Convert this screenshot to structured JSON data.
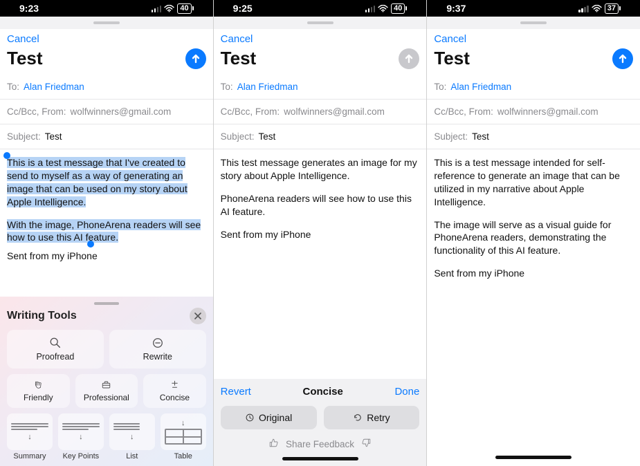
{
  "screens": [
    {
      "status": {
        "time": "9:23",
        "battery": "40"
      },
      "cancel": "Cancel",
      "title": "Test",
      "send_enabled": true,
      "to_label": "To:",
      "to_value": "Alan Friedman",
      "cc_label": "Cc/Bcc, From:",
      "cc_value": "wolfwinners@gmail.com",
      "subject_label": "Subject:",
      "subject_value": "Test",
      "body_selected_p1": "This is a test message that I've created to send to myself as a way of generating an image that can be used on my story about Apple Intelligence.",
      "body_selected_p2": "With the image, PhoneArena readers will see how to use this AI feature.",
      "signature": "Sent from my iPhone",
      "writing_tools": {
        "title": "Writing Tools",
        "proofread": "Proofread",
        "rewrite": "Rewrite",
        "friendly": "Friendly",
        "professional": "Professional",
        "concise": "Concise",
        "summary": "Summary",
        "key_points": "Key Points",
        "list": "List",
        "table": "Table"
      }
    },
    {
      "status": {
        "time": "9:25",
        "battery": "40"
      },
      "cancel": "Cancel",
      "title": "Test",
      "send_enabled": false,
      "to_label": "To:",
      "to_value": "Alan Friedman",
      "cc_label": "Cc/Bcc, From:",
      "cc_value": "wolfwinners@gmail.com",
      "subject_label": "Subject:",
      "subject_value": "Test",
      "body_p1": "This test message generates an image for my story about Apple Intelligence.",
      "body_p2": "PhoneArena readers will see how to use this AI feature.",
      "signature": "Sent from my iPhone",
      "action_bar": {
        "revert": "Revert",
        "title": "Concise",
        "done": "Done",
        "original": "Original",
        "retry": "Retry",
        "share_feedback": "Share Feedback"
      }
    },
    {
      "status": {
        "time": "9:37",
        "battery": "37"
      },
      "cancel": "Cancel",
      "title": "Test",
      "send_enabled": true,
      "to_label": "To:",
      "to_value": "Alan Friedman",
      "cc_label": "Cc/Bcc, From:",
      "cc_value": "wolfwinners@gmail.com",
      "subject_label": "Subject:",
      "subject_value": "Test",
      "body_p1": "This is a test message intended for self-reference to generate an image that can be utilized in my narrative about Apple Intelligence.",
      "body_p2": "The image will serve as a visual guide for PhoneArena readers, demonstrating the functionality of this AI feature.",
      "signature": "Sent from my iPhone"
    }
  ]
}
